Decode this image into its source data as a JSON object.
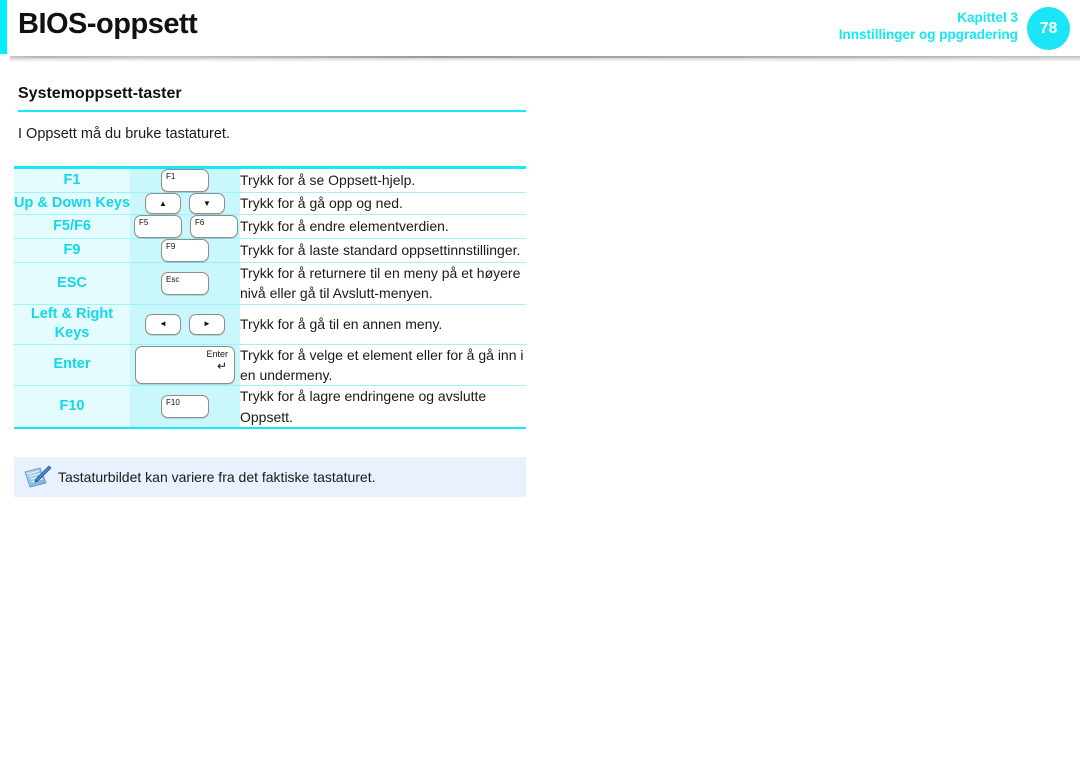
{
  "header": {
    "title": "BIOS-oppsett",
    "chapter": "Kapittel 3",
    "chapter_subtitle": "Innstillinger og ppgradering",
    "page_number": "78",
    "accent_color": "#00f0ff",
    "badge_color": "#1ae4f6"
  },
  "section": {
    "heading": "Systemoppsett-taster",
    "intro": "I Oppsett må du bruke tastaturet."
  },
  "table": {
    "rows": [
      {
        "name": "F1",
        "keys": [
          {
            "style": "fn",
            "label": "F1"
          }
        ],
        "description": "Trykk for å se Oppsett-hjelp."
      },
      {
        "name": "Up & Down Keys",
        "keys": [
          {
            "style": "arrow",
            "label": "▲"
          },
          {
            "style": "arrow",
            "label": "▼"
          }
        ],
        "description": "Trykk for å gå opp og ned."
      },
      {
        "name": "F5/F6",
        "keys": [
          {
            "style": "fn",
            "label": "F5"
          },
          {
            "style": "fn",
            "label": "F6"
          }
        ],
        "description": "Trykk for å endre elementverdien."
      },
      {
        "name": "F9",
        "keys": [
          {
            "style": "fn",
            "label": "F9"
          }
        ],
        "description": "Trykk for å laste standard oppsettinnstillinger."
      },
      {
        "name": "ESC",
        "keys": [
          {
            "style": "fn",
            "label": "Esc"
          }
        ],
        "description": "Trykk for å returnere til en meny på et høyere nivå eller gå til Avslutt-menyen."
      },
      {
        "name": "Left & Right Keys",
        "keys": [
          {
            "style": "arrow",
            "label": "◄"
          },
          {
            "style": "arrow",
            "label": "►"
          }
        ],
        "description": "Trykk for å gå til en annen meny."
      },
      {
        "name": "Enter",
        "keys": [
          {
            "style": "enter",
            "label": "Enter",
            "arrow": "↵"
          }
        ],
        "description": "Trykk for å velge et element eller for å gå inn i en undermeny."
      },
      {
        "name": "F10",
        "keys": [
          {
            "style": "fn",
            "label": "F10"
          }
        ],
        "description": "Trykk for å lagre endringene og avslutte Oppsett."
      }
    ]
  },
  "note": {
    "icon": "note-pen-icon",
    "text": "Tastaturbildet kan variere fra det faktiske tastaturet.",
    "background_color": "#e8f1fd"
  }
}
